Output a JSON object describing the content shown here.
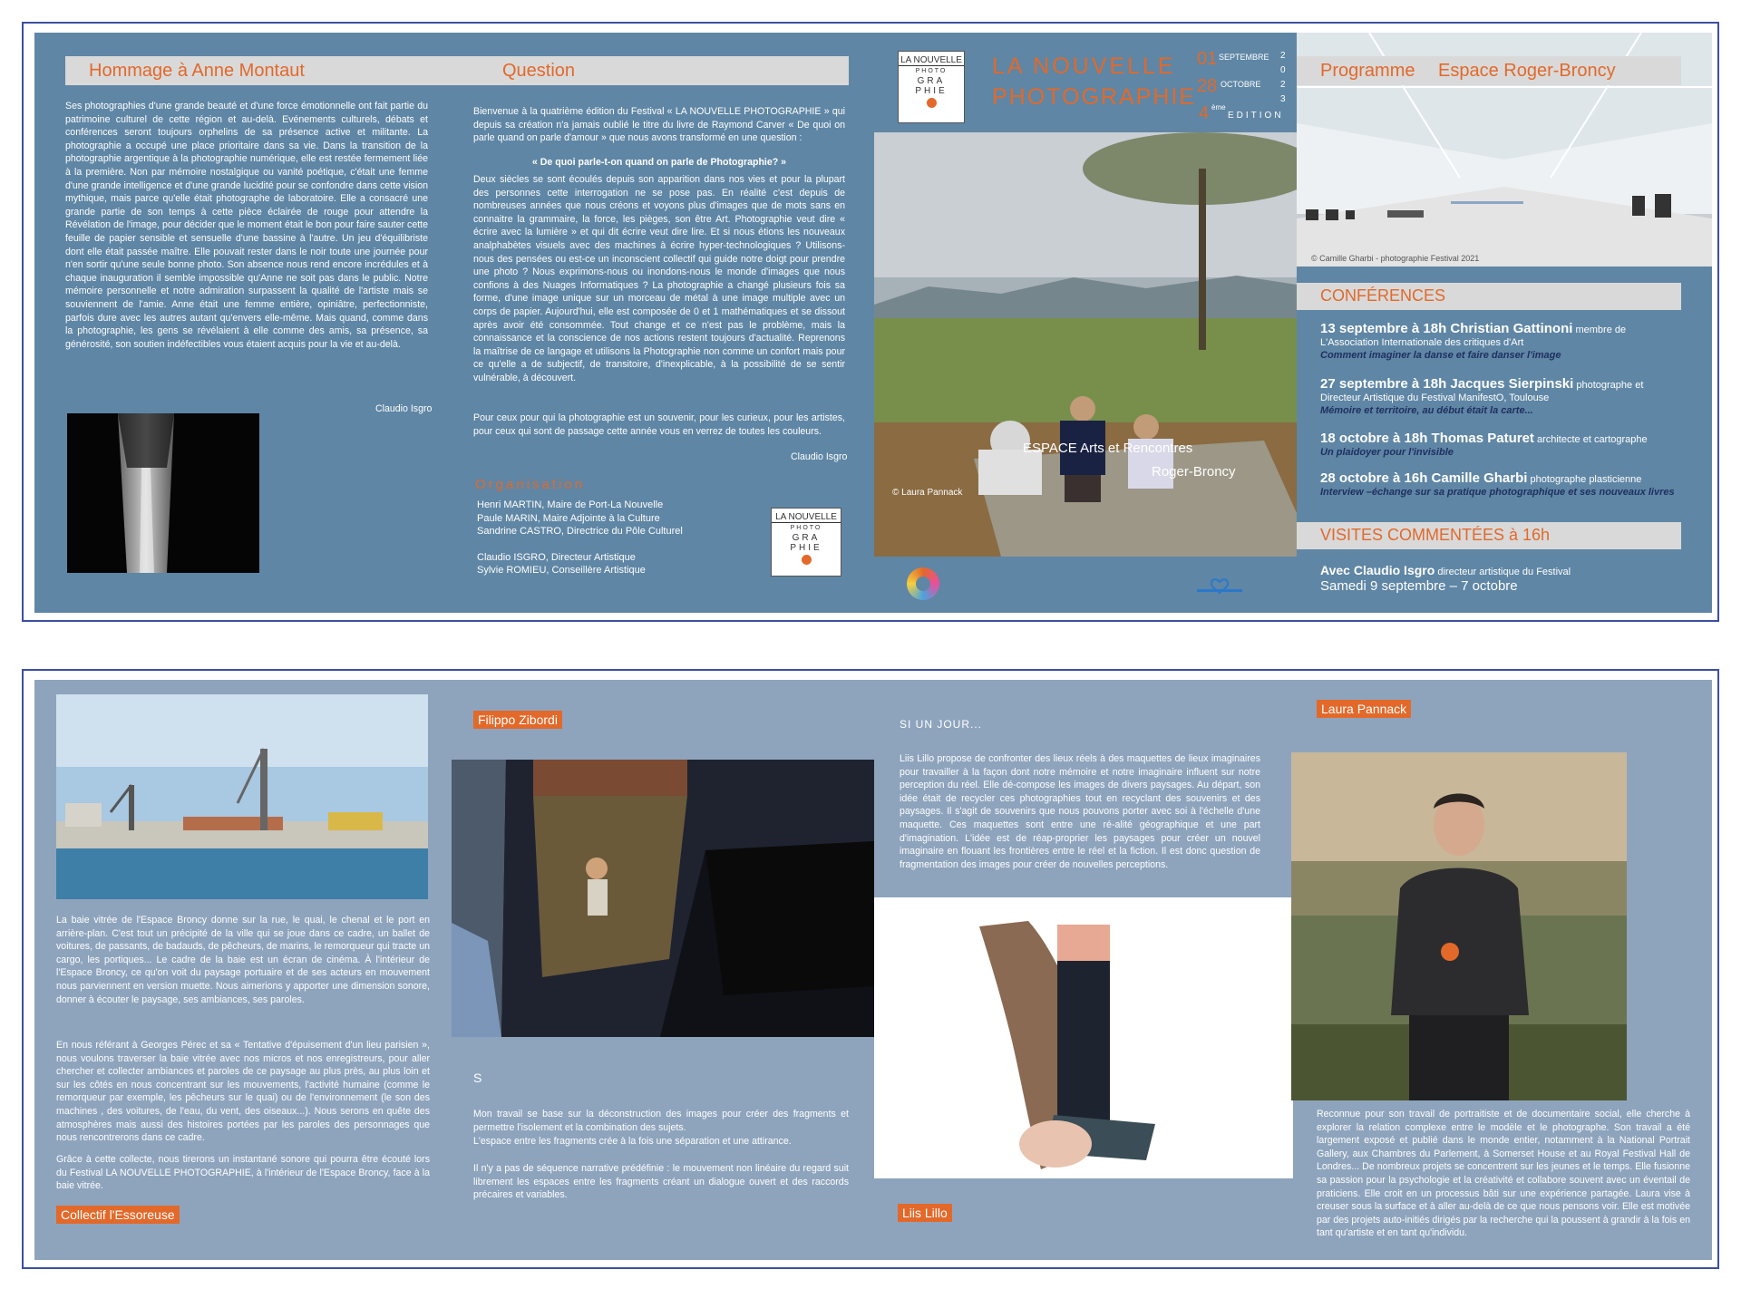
{
  "left_panel": {
    "hommage_title": "Hommage à Anne Montaut",
    "question_title": "Question",
    "hommage_text": "Ses photographies d'une grande beauté et d'une force émotionnelle ont fait partie du patrimoine culturel de cette région et au-delà. Evénements culturels, débats et conférences seront toujours orphelins de sa présence active et militante. La photographie a occupé une place prioritaire dans sa vie. Dans la transition de la photographie argentique à la photographie numérique, elle est restée fermement liée à la première. Non par mémoire nostalgique ou vanité poétique, c'était une femme d'une grande intelligence et d'une grande lucidité pour se confondre dans cette vision mythique, mais parce qu'elle était photographe de laboratoire. Elle a consacré une grande partie de son temps à cette pièce éclairée de rouge pour attendre la Révélation de l'image, pour décider que le moment était le bon pour faire sauter cette feuille de papier sensible et sensuelle d'une bassine à l'autre. Un jeu d'équilibriste dont elle était passée maître. Elle pouvait rester dans le noir toute une journée pour n'en sortir qu'une seule bonne photo. Son absence nous rend encore incrédules et à chaque inauguration il semble impossible qu'Anne ne soit pas dans le public. Notre mémoire personnelle et notre admiration surpassent la qualité de l'artiste mais se souviennent de l'amie. Anne était une femme entière, opiniâtre, perfectionniste, parfois dure avec les autres autant qu'envers elle-même. Mais quand, comme dans la photographie, les gens se révélaient à elle comme des amis, sa présence, sa générosité, son soutien indéfectibles vous étaient acquis pour la vie et au-delà.",
    "hommage_sig": "Claudio Isgro",
    "question_intro": "Bienvenue à la quatrième édition du Festival « LA NOUVELLE PHOTOGRAPHIE » qui depuis sa création n'a jamais oublié le titre du livre de Raymond Carver « De quoi on parle quand on parle d'amour » que nous avons transformé en une question :",
    "question_q": "« De quoi parle-t-on quand on parle de Photographie? »",
    "question_text": "Deux siècles se sont écoulés depuis son apparition dans nos vies et pour la plupart des personnes cette interrogation ne se pose pas. En réalité c'est depuis de nombreuses années que nous créons et voyons plus d'images que de mots sans en connaitre la grammaire, la force, les pièges, son être Art. Photographie veut dire « écrire avec la lumière » et qui dit écrire veut dire lire. Et si nous étions les nouveaux analphabètes visuels avec des machines à écrire hyper-technologiques ? Utilisons-nous des pensées ou est-ce un inconscient collectif qui guide notre doigt pour prendre une photo ? Nous exprimons-nous ou inondons-nous le monde d'images que nous confions à des Nuages Informatiques ? La photographie a changé plusieurs fois sa forme, d'une image unique sur un morceau de métal à une image multiple avec un corps de papier. Aujourd'hui, elle est composée de 0 et 1 mathématiques et se dissout après avoir été consommée. Tout change et ce n'est pas le problème, mais la connaissance et la conscience de nos actions restent toujours d'actualité. Reprenons la maîtrise de ce langage et utilisons la Photographie non comme un confort mais pour ce qu'elle a de subjectif, de transitoire, d'inexplicable, à la possibilité de se sentir vulnérable, à découvert.",
    "question_end": "Pour ceux pour qui la photographie est un souvenir, pour les curieux, pour les artistes, pour ceux qui sont de passage cette année vous en verrez de toutes les couleurs.",
    "question_sig": "Claudio Isgro",
    "org_title": "Organisation",
    "org_lines": [
      "Henri MARTIN, Maire de Port-La Nouvelle",
      "Paule MARIN, Maire Adjointe à la Culture",
      "Sandrine CASTRO, Directrice du Pôle Culturel",
      "",
      "Claudio ISGRO, Directeur Artistique",
      "Sylvie ROMIEU, Conseillère Artistique"
    ]
  },
  "logo": {
    "l1": "LA NOUVELLE",
    "l2": "PHOTO",
    "l3": "GRA",
    "l4": "PHIE"
  },
  "cover": {
    "title1": "LA NOUVELLE",
    "title2": "PHOTOGRAPHIE",
    "d1": "01",
    "m1": "SEPTEMBRE",
    "d2": "28",
    "m2": "OCTOBRE",
    "ed_num": "4",
    "ed_sup": "ème",
    "ed_word": "EDITION",
    "year": "2023",
    "espace": "ESPACE   Arts et Rencontres",
    "place": "Roger-Broncy",
    "credit": "© Laura Pannack"
  },
  "right_panel": {
    "programme": "Programme",
    "espace": "Espace Roger-Broncy",
    "photo_credit": "© Camille Gharbi - photographie Festival 2021",
    "conferences": "CONFÉRENCES",
    "confs": [
      {
        "date": "13 septembre à 18h Christian Gattinoni",
        "desc": " membre de L'Association Internationale des critiques d'Art",
        "sub": "Comment imaginer la danse et faire danser l'image"
      },
      {
        "date": "27 septembre à 18h Jacques Sierpinski",
        "desc": " photographe et Directeur Artistique du Festival ManifestO, Toulouse",
        "sub": "Mémoire et territoire, au début était la carte..."
      },
      {
        "date": "18 octobre à 18h Thomas Paturet",
        "desc": " architecte et cartographe",
        "sub": "Un plaidoyer pour l'invisible"
      },
      {
        "date": "28 octobre à 16h Camille Gharbi",
        "desc": "  photographe plasticienne",
        "sub": "Interview –échange  sur sa pratique photographique et ses nouveaux livres"
      }
    ],
    "visites": "VISITES COMMENTÉES à 16h",
    "visite_who": "Avec Claudio Isgro",
    "visite_desc": " directeur artistique du Festival",
    "visite_dates": "Samedi 9 septembre – 7 octobre"
  },
  "back": {
    "essoreuse_p1": "La baie vitrée de l'Espace Broncy donne sur la rue, le quai, le chenal et le port en arrière-plan. C'est tout un précipité de la ville qui se joue dans ce cadre, un ballet de voitures, de passants, de badauds, de pêcheurs, de marins, le remorqueur qui tracte un cargo, les portiques... Le cadre de la baie est un écran de cinéma. À l'intérieur de l'Espace Broncy, ce qu'on voit du paysage portuaire et de ses acteurs en mouvement nous parviennent en version muette. Nous aimerions y apporter une dimension sonore, donner à écouter le paysage, ses ambiances, ses paroles.",
    "essoreuse_p2": "En nous référant à Georges Pérec et sa « Tentative d'épuisement d'un lieu parisien », nous voulons traverser la baie vitrée avec nos micros et nos enregistreurs, pour aller chercher et collecter ambiances et paroles de ce paysage au plus près, au plus loin et sur les côtés en nous concentrant sur les mouvements, l'activité humaine (comme le remorqueur par exemple, les pêcheurs sur le quai) ou de l'environnement (le son des machines , des voitures, de l'eau, du vent, des oiseaux...). Nous serons en quête des atmosphères mais aussi des histoires portées par les paroles des personnages que nous rencontrerons dans ce cadre.",
    "essoreuse_p3": "Grâce à cette collecte, nous tirerons un instantané sonore qui pourra être écouté lors du Festival LA NOUVELLE PHOTOGRAPHIE, à l'intérieur de l'Espace Broncy, face à la baie vitrée.",
    "essoreuse_tag": "Collectif l'Essoreuse",
    "filippo_tag": "Filippo Zibordi",
    "filippo_s": "S",
    "filippo_p1": "Mon travail se base sur la déconstruction des images pour créer des fragments et permettre l'isolement et la combination des sujets.",
    "filippo_p2": "L'espace entre les fragments crée à la fois une séparation et une attirance.",
    "filippo_p3": "Il n'y a pas de séquence narrative prédéfinie : le mouvement non linéaire du regard suit librement les espaces entre les fragments créant un dialogue ouvert et des raccords précaires et variables.",
    "liis_title": "SI UN JOUR...",
    "liis_text": "Liis Lillo propose de confronter des lieux réels à des maquettes de lieux imaginaires pour travailler à la façon dont notre mémoire et notre imaginaire influent sur notre perception du réel. Elle dé-compose les images de divers paysages. Au départ, son idée était de recycler ces photographies tout en recyclant des souvenirs et des paysages. Il s'agit de souvenirs que nous pouvons porter avec soi à l'échelle d'une maquette. Ces maquettes sont entre une ré-alité géographique et une part d'imagination. L'idée est de réap-proprier les paysages pour créer un nouvel imaginaire en flouant les frontières entre le réel et la fiction. Il est donc question de fragmentation des images pour créer de nouvelles perceptions.",
    "liis_tag": "Liis Lillo",
    "laura_tag": "Laura Pannack",
    "laura_text": "Reconnue pour son travail de portraitiste et de documentaire social, elle cherche à explorer la relation complexe entre le modèle et le photographe. Son travail a été largement exposé et publié dans le monde entier, notamment à la National Portrait Gallery, aux Chambres du Parlement, à Somerset House et au Royal Festival Hall de Londres... De nombreux projets se concentrent sur les jeunes et le temps. Elle fusionne sa passion pour la psychologie et la créativité et collabore souvent avec un éventail de praticiens. Elle croit en un processus bâti sur une expérience partagée. Laura vise à creuser sous la surface et à aller au-delà de ce que nous pensons voir. Elle est motivée par des projets auto-initiés dirigés par la recherche qui la poussent à grandir à la fois en tant qu'artiste et en tant qu'individu."
  }
}
